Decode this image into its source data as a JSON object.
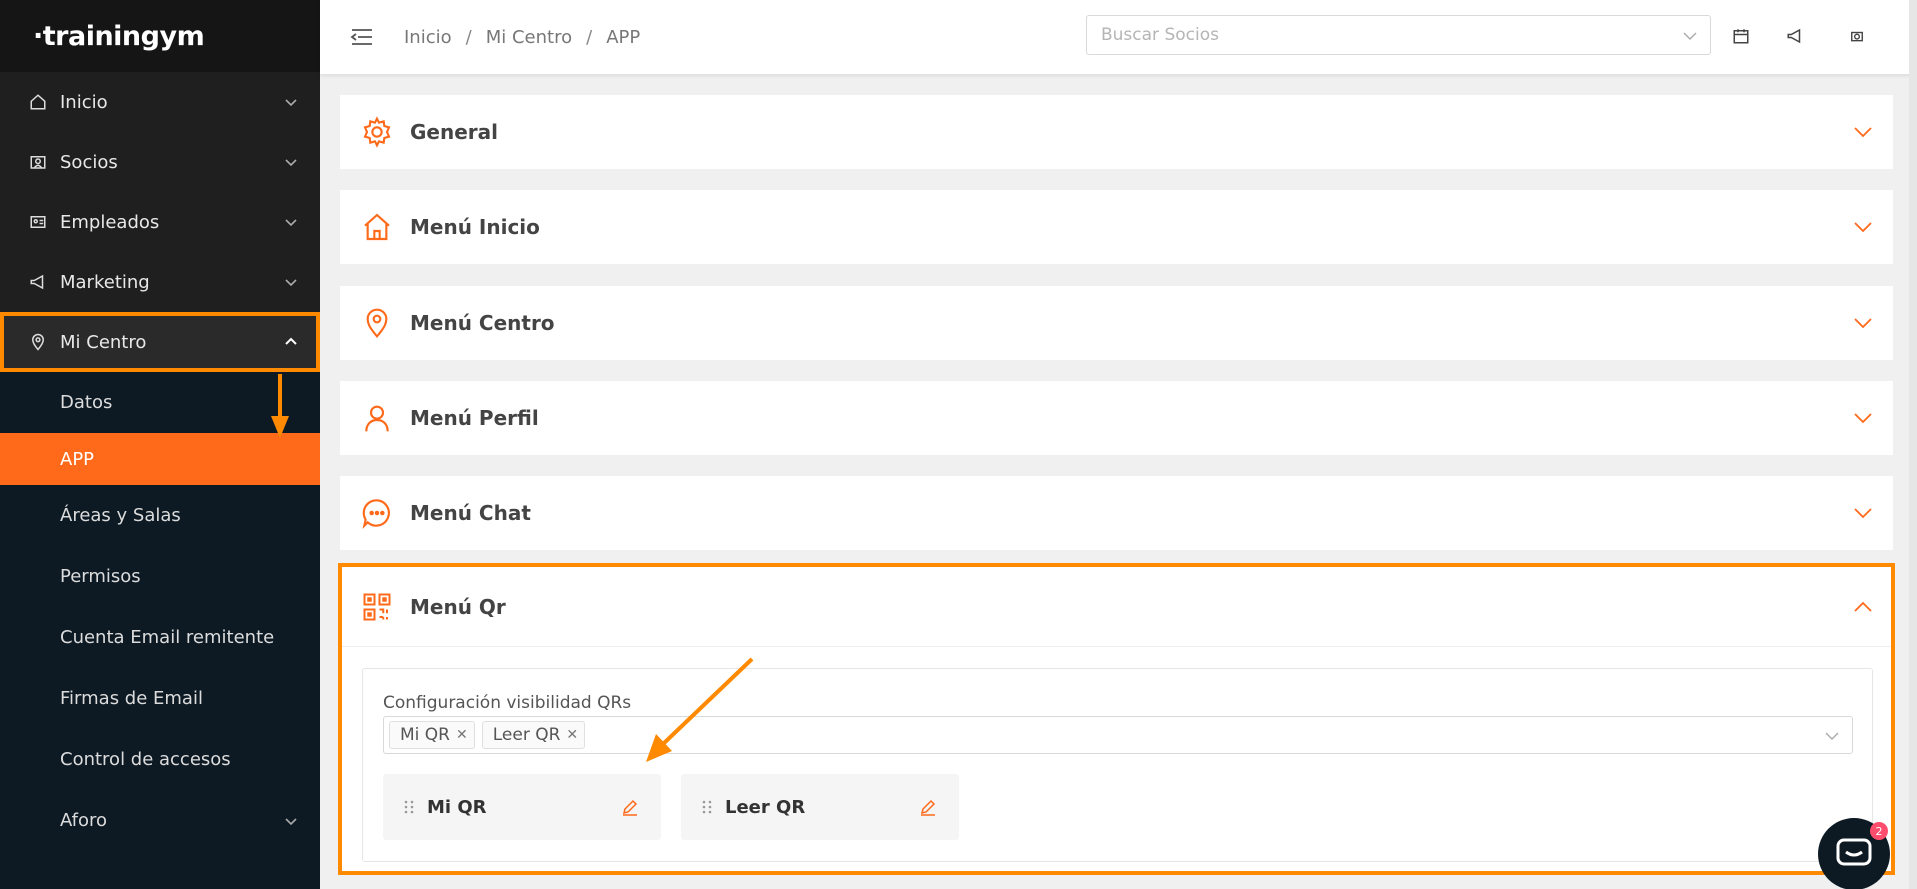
{
  "app": {
    "logo": "·trainingym"
  },
  "sidebar": {
    "items": [
      {
        "label": "Inicio"
      },
      {
        "label": "Socios"
      },
      {
        "label": "Empleados"
      },
      {
        "label": "Marketing"
      },
      {
        "label": "Mi Centro"
      }
    ],
    "sub_items": [
      {
        "label": "Datos"
      },
      {
        "label": "APP"
      },
      {
        "label": "Áreas y Salas"
      },
      {
        "label": "Permisos"
      },
      {
        "label": "Cuenta Email remitente"
      },
      {
        "label": "Firmas de Email"
      },
      {
        "label": "Control de accesos"
      },
      {
        "label": "Aforo"
      }
    ]
  },
  "header": {
    "breadcrumb": [
      "Inicio",
      "Mi Centro",
      "APP"
    ],
    "search_placeholder": "Buscar Socios"
  },
  "panels": [
    {
      "title": "General",
      "icon": "gear-icon"
    },
    {
      "title": "Menú Inicio",
      "icon": "home-icon"
    },
    {
      "title": "Menú Centro",
      "icon": "location-pin-icon"
    },
    {
      "title": "Menú Perfil",
      "icon": "user-icon"
    },
    {
      "title": "Menú Chat",
      "icon": "chat-bubble-icon"
    }
  ],
  "qr_menu": {
    "title": "Menú Qr",
    "field_label": "Configuración visibilidad QRs",
    "tags": [
      "Mi QR",
      "Leer QR"
    ],
    "items": [
      "Mi QR",
      "Leer QR"
    ]
  },
  "chat_widget": {
    "badge": "2"
  },
  "colors": {
    "accent": "#ff6a1a",
    "annotation": "#ff8a00",
    "sidebar_bg": "#0d1a24"
  }
}
